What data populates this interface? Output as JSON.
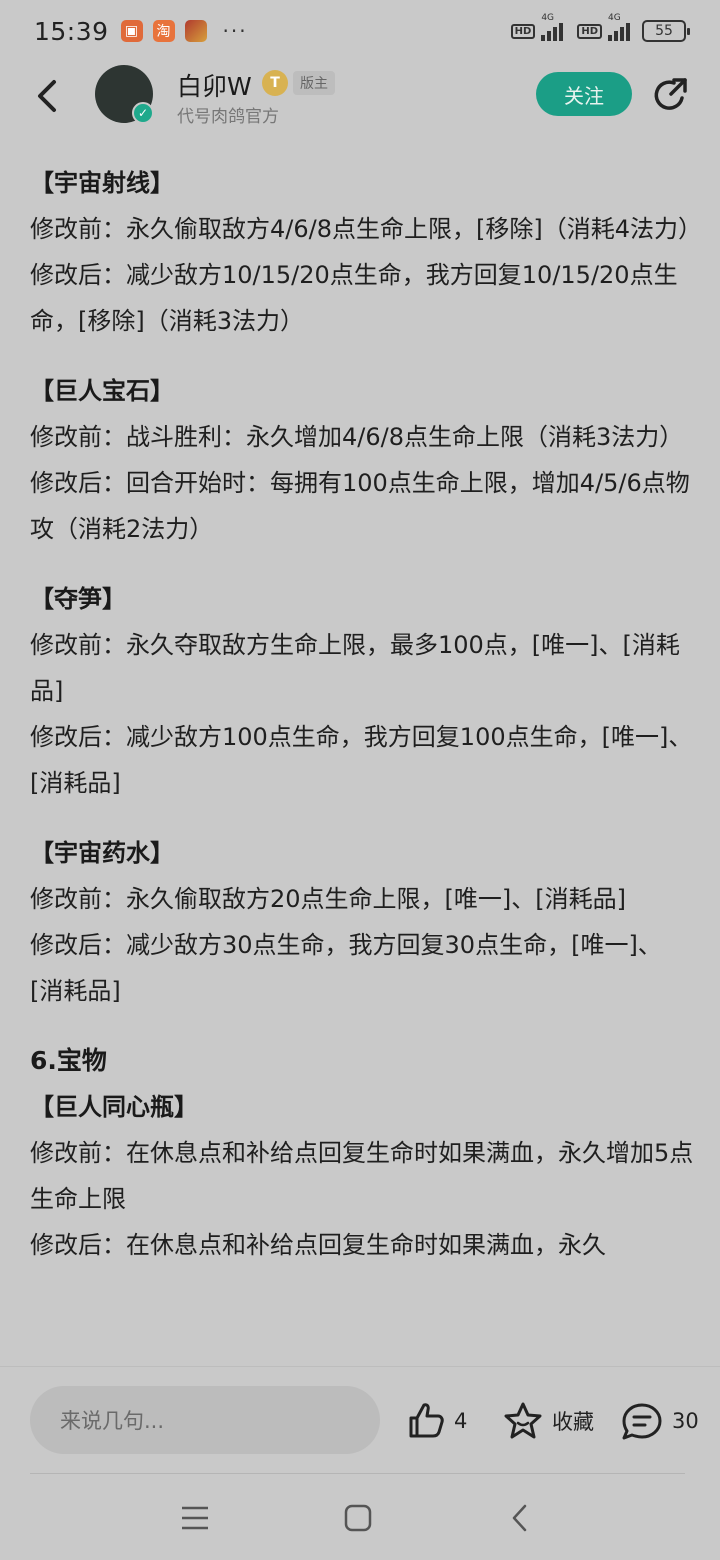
{
  "status_bar": {
    "time": "15:39",
    "more": "···",
    "hd": "HD",
    "net": "4G",
    "battery": "55"
  },
  "header": {
    "username": "白卯W",
    "level_badge": "T",
    "role_badge": "版主",
    "subtitle": "代号肉鸽官方",
    "follow_label": "关注"
  },
  "post": {
    "sections": [
      {
        "title": "【宇宙射线】",
        "lines": [
          "修改前：永久偷取敌方4/6/8点生命上限，[移除]（消耗4法力）",
          "修改后：减少敌方10/15/20点生命，我方回复10/15/20点生命，[移除]（消耗3法力）"
        ]
      },
      {
        "title": "【巨人宝石】",
        "lines": [
          "修改前：战斗胜利：永久增加4/6/8点生命上限（消耗3法力）",
          "修改后：回合开始时：每拥有100点生命上限，增加4/5/6点物攻（消耗2法力）"
        ]
      },
      {
        "title": "【夺笋】",
        "lines": [
          "修改前：永久夺取敌方生命上限，最多100点，[唯一]、[消耗品]",
          "修改后：减少敌方100点生命，我方回复100点生命，[唯一]、[消耗品]"
        ]
      },
      {
        "title": "【宇宙药水】",
        "lines": [
          "修改前：永久偷取敌方20点生命上限，[唯一]、[消耗品]",
          "修改后：减少敌方30点生命，我方回复30点生命，[唯一]、[消耗品]"
        ]
      }
    ],
    "treasure_heading": "6.宝物",
    "treasure": {
      "title": "【巨人同心瓶】",
      "lines": [
        "修改前：在休息点和补给点回复生命时如果满血，永久增加5点生命上限",
        "修改后：在休息点和补给点回复生命时如果满血，永久"
      ]
    }
  },
  "bottom_bar": {
    "comment_placeholder": "来说几句...",
    "like_count": "4",
    "favorite_label": "收藏",
    "comment_count": "30"
  },
  "colors": {
    "accent": "#1b9e86",
    "background": "#c9c9c9"
  },
  "icons": [
    "back-icon",
    "verified-icon",
    "share-icon",
    "like-icon",
    "star-icon",
    "comment-icon",
    "menu-icon",
    "home-icon",
    "nav-back-icon"
  ]
}
